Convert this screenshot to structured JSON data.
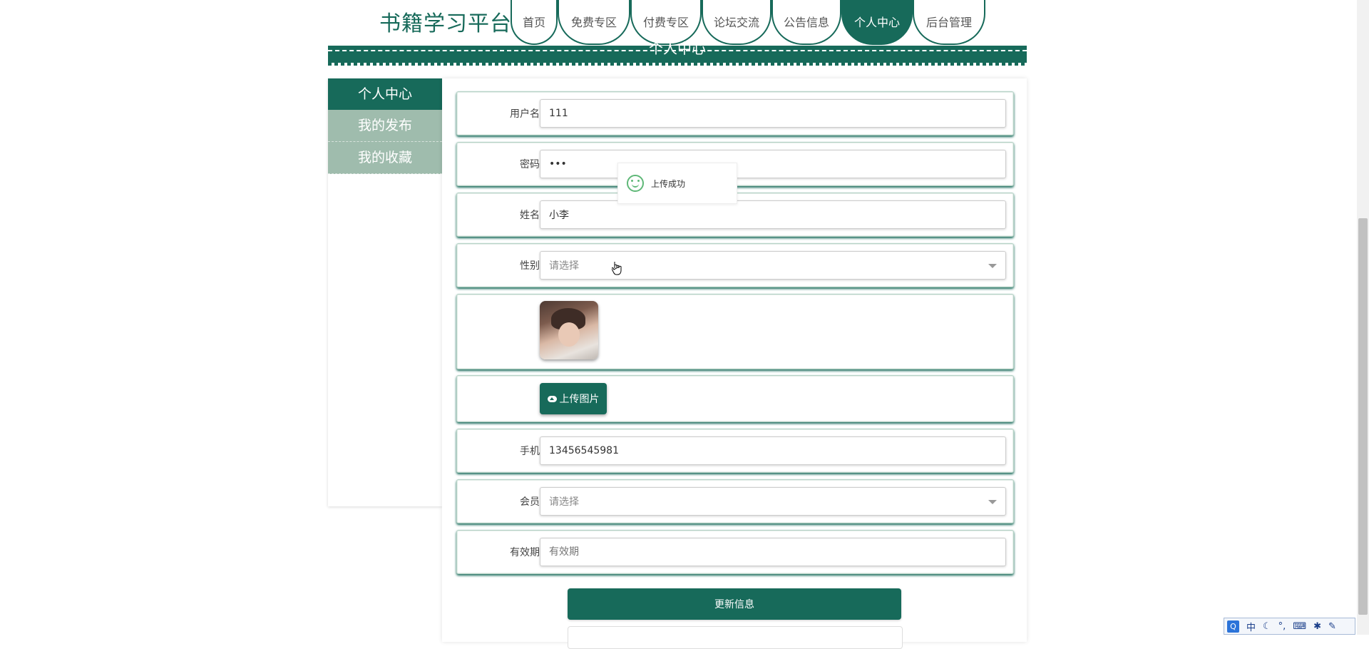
{
  "header": {
    "brand": "书籍学习平台",
    "nav": [
      {
        "label": "首页",
        "active": false
      },
      {
        "label": "免费专区",
        "active": false
      },
      {
        "label": "付费专区",
        "active": false
      },
      {
        "label": "论坛交流",
        "active": false
      },
      {
        "label": "公告信息",
        "active": false
      },
      {
        "label": "个人中心",
        "active": true
      },
      {
        "label": "后台管理",
        "active": false
      }
    ],
    "banner_title": "个人中心"
  },
  "sidebar": {
    "items": [
      {
        "label": "个人中心",
        "active": true
      },
      {
        "label": "我的发布",
        "active": false
      },
      {
        "label": "我的收藏",
        "active": false
      }
    ]
  },
  "form": {
    "username": {
      "label": "用户名",
      "value": "111"
    },
    "password": {
      "label": "密码",
      "value": "•••"
    },
    "name": {
      "label": "姓名",
      "value": "小李"
    },
    "gender": {
      "label": "性别",
      "value": "请选择"
    },
    "upload_label": "上传图片",
    "phone": {
      "label": "手机",
      "value": "13456545981"
    },
    "member": {
      "label": "会员",
      "value": "请选择"
    },
    "expiry": {
      "label": "有效期",
      "placeholder": "有效期"
    },
    "submit_label": "更新信息"
  },
  "toast": {
    "message": "上传成功"
  },
  "ime": {
    "mode": "中",
    "logo": "Q"
  },
  "colors": {
    "primary": "#176a5a",
    "sidebar_inactive": "#9fbcad",
    "success": "#5fb878"
  }
}
